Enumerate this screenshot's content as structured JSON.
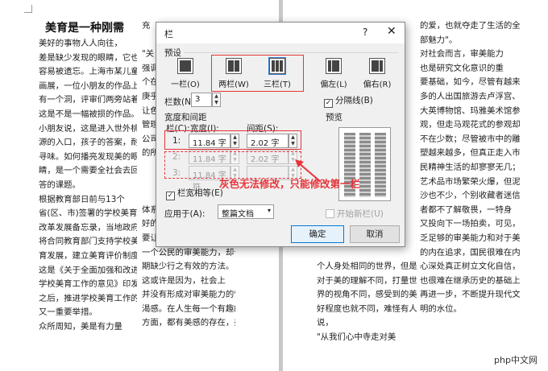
{
  "document": {
    "left_page": {
      "col1": {
        "title": "美育是一种刚需",
        "lines": [
          "美好的事物人人向往，",
          "差是缺少发现的眼睛，它也",
          "容易被遗忘。上海市某儿童",
          "画展，一位小朋友的作品上",
          "有一个洞，评审们两旁站着，",
          "这是不是一幅被损的作品。",
          "小朋友说，这是进入世外桃",
          "源的入口，孩子的答案，耐人",
          "寻味。如何播亮发现美的眼",
          "睛，是一个需要全社会去回",
          "答的课题。",
          "根据教育部日前与13个",
          "省(区、市)签署的学校美育",
          "改革发展备忘录，当地政府",
          "将合同教育部门支持学校美",
          "育发展，建立美育评价制度。",
          "这是《关于全面加强和改进",
          "学校美育工作的意见》印发",
          "之后，推进学校美育工作的",
          "又一重要举措。",
          "众所周知，美是有力量"
        ]
      },
      "col2": {
        "lines": [
          "充",
          "",
          "\"关",
          "强调",
          "个在",
          "庚乎",
          "让色",
          "管理",
          "公司",
          "的所",
          "",
          "",
          "",
          "体系",
          "好的",
          "要让",
          "一个公民的审美能力，却长",
          "期缺少行之有效的方法。",
          "这或许是因为，社会上",
          "并没有形成对审美能力的饥",
          "渴感。在人生每一个有趣的",
          "方面，都有美感的存在，美术"
        ]
      }
    },
    "right_page": {
      "col1": {
        "lines": [
          "",
          "",
          "",
          "",
          "",
          "",
          "",
          "",
          "",
          "",
          "",
          "",
          "",
          "",
          "",
          "",
          "",
          "个人身处相同的世界，但是",
          "对于美的理解不同，打量世",
          "界的视角不同，感受到的美",
          "好程度也就不同，难怪有人",
          "说，",
          "\"从我们心中寺走对美"
        ]
      },
      "col2": {
        "lines": [
          "的爱，也就夺走了生活的全",
          "部魅力\"。",
          "对社会而言，审美能力",
          "也是研究文化意识的重",
          "要基础，如今，尽管有越来越",
          "多的人出国旅游去卢浮宫、",
          "大英博物馆、玛雅美术馆参",
          "观，但走马观花式的参观却",
          "不在少数；尽管被市中的雕",
          "塑越来越多，但真正走入市",
          "民精神生活的却寥寥无几；",
          "艺术品市场繁荣火爆，但泥",
          "沙也不少，个别收藏者迷信",
          "者都不了解敬畏，一特身",
          "又投向下一场拍卖，可见，缺",
          "乏足够的审美能力和对于美",
          "的内在追求，国民很难在内",
          "心深处真正树立文化自信，",
          "也很难在继承历史的基础上",
          "再进一步，不断提升现代文",
          "明的水位。"
        ]
      }
    }
  },
  "dialog": {
    "title": "栏",
    "help": "?",
    "close": "✕",
    "preset_label": "预设",
    "presets": [
      {
        "label": "一栏(O)",
        "icon": "one-column-icon",
        "cols": 1
      },
      {
        "label": "两栏(W)",
        "icon": "two-columns-icon",
        "cols": 2
      },
      {
        "label": "三栏(T)",
        "icon": "three-columns-icon",
        "cols": 3
      },
      {
        "label": "偏左(L)",
        "icon": "left-column-icon",
        "cols": 2
      },
      {
        "label": "偏右(R)",
        "icon": "right-column-icon",
        "cols": 2
      }
    ],
    "columns_label": "栏数(N):",
    "columns_value": "3",
    "separator_label": "分隔线(B)",
    "separator_checked": "✓",
    "width_spacing_label": "宽度和间距",
    "col_header": "栏(C):",
    "width_header": "宽度(I):",
    "spacing_header": "间距(S):",
    "rows": [
      {
        "num": "1:",
        "width": "11.84 字符",
        "spacing": "2.02 字符"
      },
      {
        "num": "2:",
        "width": "11.84 字符",
        "spacing": "2.02 字符"
      },
      {
        "num": "3:",
        "width": "11.84 字符",
        "spacing": ""
      }
    ],
    "equal_width_label": "栏宽相等(E)",
    "equal_width_checked": "✓",
    "preview_label": "预览",
    "apply_label": "应用于(A):",
    "apply_value": "整篇文档",
    "new_column_label": "开始新栏(U)",
    "ok_label": "确定",
    "cancel_label": "取消"
  },
  "annotation": "灰色无法修改，只能修改第一栏",
  "watermark": "php中文网",
  "colors": {
    "annotation_red": "#e8343a",
    "primary_button_border": "#0078d7"
  }
}
